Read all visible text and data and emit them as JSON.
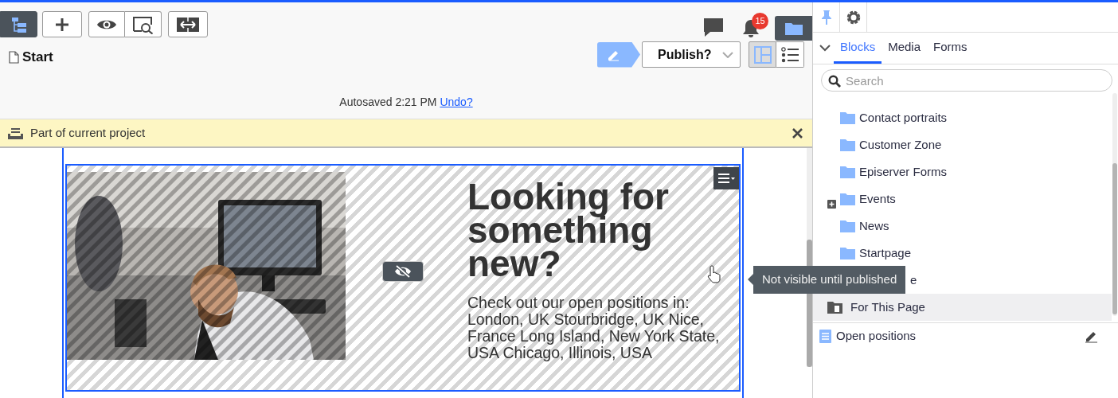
{
  "toolbar": {
    "buttons": [
      {
        "kind": "tree",
        "selected": true
      },
      {
        "kind": "add",
        "selected": false
      },
      {
        "kind": "preview",
        "selected": false
      },
      {
        "kind": "compare",
        "selected": false
      },
      {
        "kind": "resize",
        "selected": false
      }
    ]
  },
  "notifications": {
    "badge": "15"
  },
  "page": {
    "title": "Start"
  },
  "publish": {
    "label": "Publish?"
  },
  "view_toggle": [
    {
      "kind": "onpage",
      "selected": true
    },
    {
      "kind": "list",
      "selected": false
    }
  ],
  "autosave": {
    "text": "Autosaved 2:21 PM",
    "link": "Undo?"
  },
  "notice": {
    "text": "Part of current project"
  },
  "block": {
    "heading": "Looking for something new?",
    "body": "Check out our open positions in: London, UK Stourbridge, UK Nice, France Long Island, New York State, USA Chicago, Illinois, USA"
  },
  "tooltip": {
    "text": "Not visible until published"
  },
  "panel": {
    "top_tabs": [
      {
        "kind": "pin",
        "selected": true
      },
      {
        "kind": "settings",
        "selected": false
      }
    ],
    "tabs": [
      {
        "label": "Blocks",
        "selected": true
      },
      {
        "label": "Media",
        "selected": false
      },
      {
        "label": "Forms",
        "selected": false
      }
    ],
    "search": {
      "placeholder": "Search"
    },
    "tree": [
      {
        "kind": "folder",
        "label": "Contact portraits",
        "expandable": false,
        "selected": false
      },
      {
        "kind": "folder",
        "label": "Customer Zone",
        "expandable": false,
        "selected": false
      },
      {
        "kind": "folder",
        "label": "Episerver Forms",
        "expandable": false,
        "selected": false
      },
      {
        "kind": "folder",
        "label": "Events",
        "expandable": true,
        "selected": false
      },
      {
        "kind": "folder",
        "label": "News",
        "expandable": false,
        "selected": false
      },
      {
        "kind": "folder",
        "label": "Startpage",
        "expandable": false,
        "selected": false
      },
      {
        "kind": "covered",
        "label": "e",
        "selected": false
      },
      {
        "kind": "local",
        "label": "For This Page",
        "selected": true
      }
    ],
    "items": [
      {
        "label": "Open positions"
      }
    ]
  }
}
